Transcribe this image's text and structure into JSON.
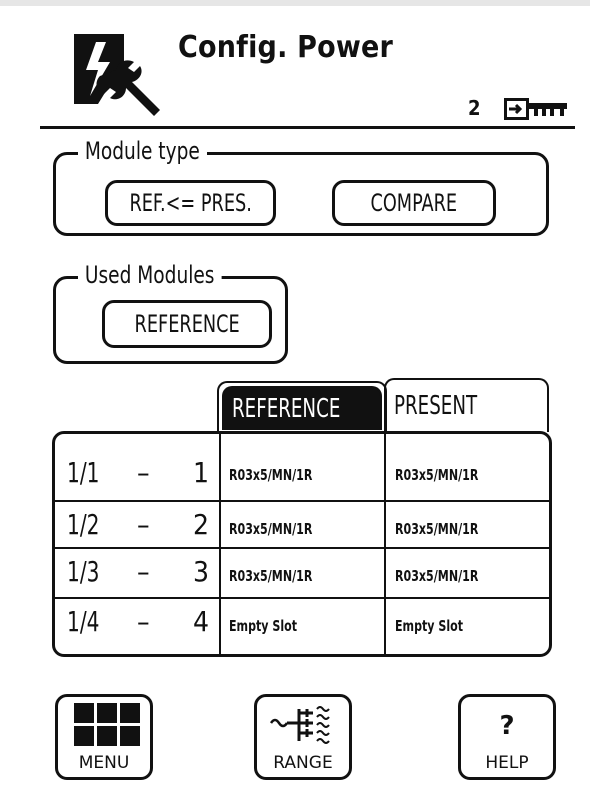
{
  "header": {
    "title": "Config. Power",
    "access_level": "2",
    "app_icon": "power-wrench-icon",
    "key_icon": "access-key-icon"
  },
  "module_type": {
    "label": "Module type",
    "ref_pres_button": "REF.<= PRES.",
    "compare_button": "COMPARE"
  },
  "used_modules": {
    "label": "Used Modules",
    "button": "REFERENCE"
  },
  "table": {
    "tabs": [
      {
        "label": "REFERENCE",
        "active": true
      },
      {
        "label": "PRESENT",
        "active": false
      }
    ],
    "rows": [
      {
        "slot": "1/1",
        "dash": "–",
        "num": "1",
        "reference": "R03x5/MN/1R",
        "present": "R03x5/MN/1R"
      },
      {
        "slot": "1/2",
        "dash": "–",
        "num": "2",
        "reference": "R03x5/MN/1R",
        "present": "R03x5/MN/1R"
      },
      {
        "slot": "1/3",
        "dash": "–",
        "num": "3",
        "reference": "R03x5/MN/1R",
        "present": "R03x5/MN/1R"
      },
      {
        "slot": "1/4",
        "dash": "–",
        "num": "4",
        "reference": "Empty Slot",
        "present": "Empty Slot"
      }
    ]
  },
  "footer": {
    "menu_label": "MENU",
    "range_label": "RANGE",
    "help_label": "HELP",
    "help_glyph": "?",
    "menu_icon": "grid-icon",
    "range_icon": "range-icon"
  },
  "colors": {
    "foreground": "#111111",
    "background": "#ffffff",
    "active_tab_bg": "#111111",
    "active_tab_fg": "#ffffff"
  }
}
